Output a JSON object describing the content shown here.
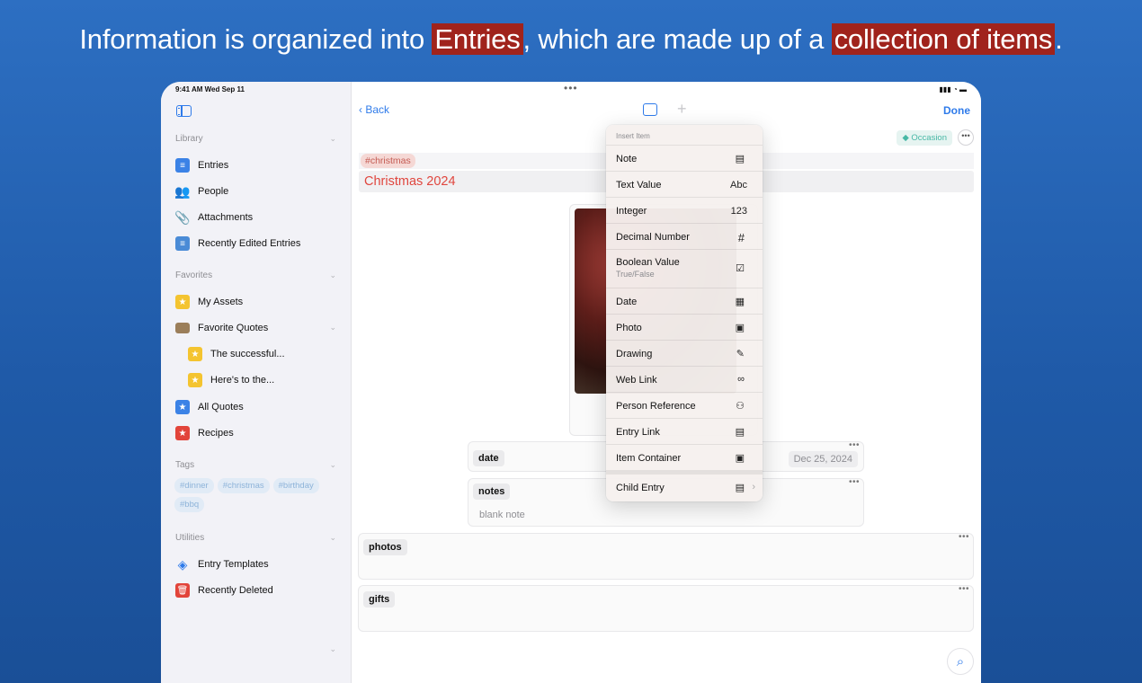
{
  "headline": {
    "part1": "Information is organized into ",
    "highlight1": "Entries",
    "part2": ", which are made up of a ",
    "highlight2": "collection of items",
    "part3": "."
  },
  "status_bar": {
    "time": "9:41 AM  Wed Sep 11"
  },
  "sidebar": {
    "library_header": "Library",
    "library_items": [
      {
        "label": "Entries"
      },
      {
        "label": "People"
      },
      {
        "label": "Attachments"
      },
      {
        "label": "Recently Edited Entries"
      }
    ],
    "favorites_header": "Favorites",
    "favorites_items": [
      {
        "label": "My Assets"
      },
      {
        "label": "Favorite Quotes"
      },
      {
        "label": "The successful..."
      },
      {
        "label": "Here's to the..."
      },
      {
        "label": "All Quotes"
      },
      {
        "label": "Recipes"
      }
    ],
    "tags_header": "Tags",
    "tags": [
      "#dinner",
      "#christmas",
      "#birthday",
      "#bbq"
    ],
    "utilities_header": "Utilities",
    "utilities_items": [
      {
        "label": "Entry Templates"
      },
      {
        "label": "Recently Deleted"
      }
    ]
  },
  "main": {
    "back_label": "Back",
    "done_label": "Done",
    "occasion_label": "Occasion",
    "tag": "#christmas",
    "title": "Christmas 2024",
    "fields": {
      "date_label": "date",
      "date_value": "Dec 25, 2024",
      "notes_label": "notes",
      "notes_value": "blank note",
      "photos_label": "photos",
      "gifts_label": "gifts"
    }
  },
  "menu": {
    "header": "Insert Item",
    "items": [
      {
        "label": "Note",
        "icon": "note-icon"
      },
      {
        "label": "Text Value",
        "right": "Abc"
      },
      {
        "label": "Integer",
        "right": "123"
      },
      {
        "label": "Decimal Number",
        "right": "#"
      },
      {
        "label": "Boolean Value",
        "sub": "True/False",
        "icon": "checkbox-icon"
      },
      {
        "label": "Date",
        "icon": "calendar-icon"
      },
      {
        "label": "Photo",
        "icon": "photo-icon"
      },
      {
        "label": "Drawing",
        "icon": "pencil-icon"
      },
      {
        "label": "Web Link",
        "icon": "link-icon"
      },
      {
        "label": "Person Reference",
        "icon": "people-icon"
      },
      {
        "label": "Entry Link",
        "icon": "entry-link-icon"
      },
      {
        "label": "Item Container",
        "icon": "container-icon"
      },
      {
        "label": "Child Entry",
        "icon": "child-entry-icon"
      }
    ]
  }
}
